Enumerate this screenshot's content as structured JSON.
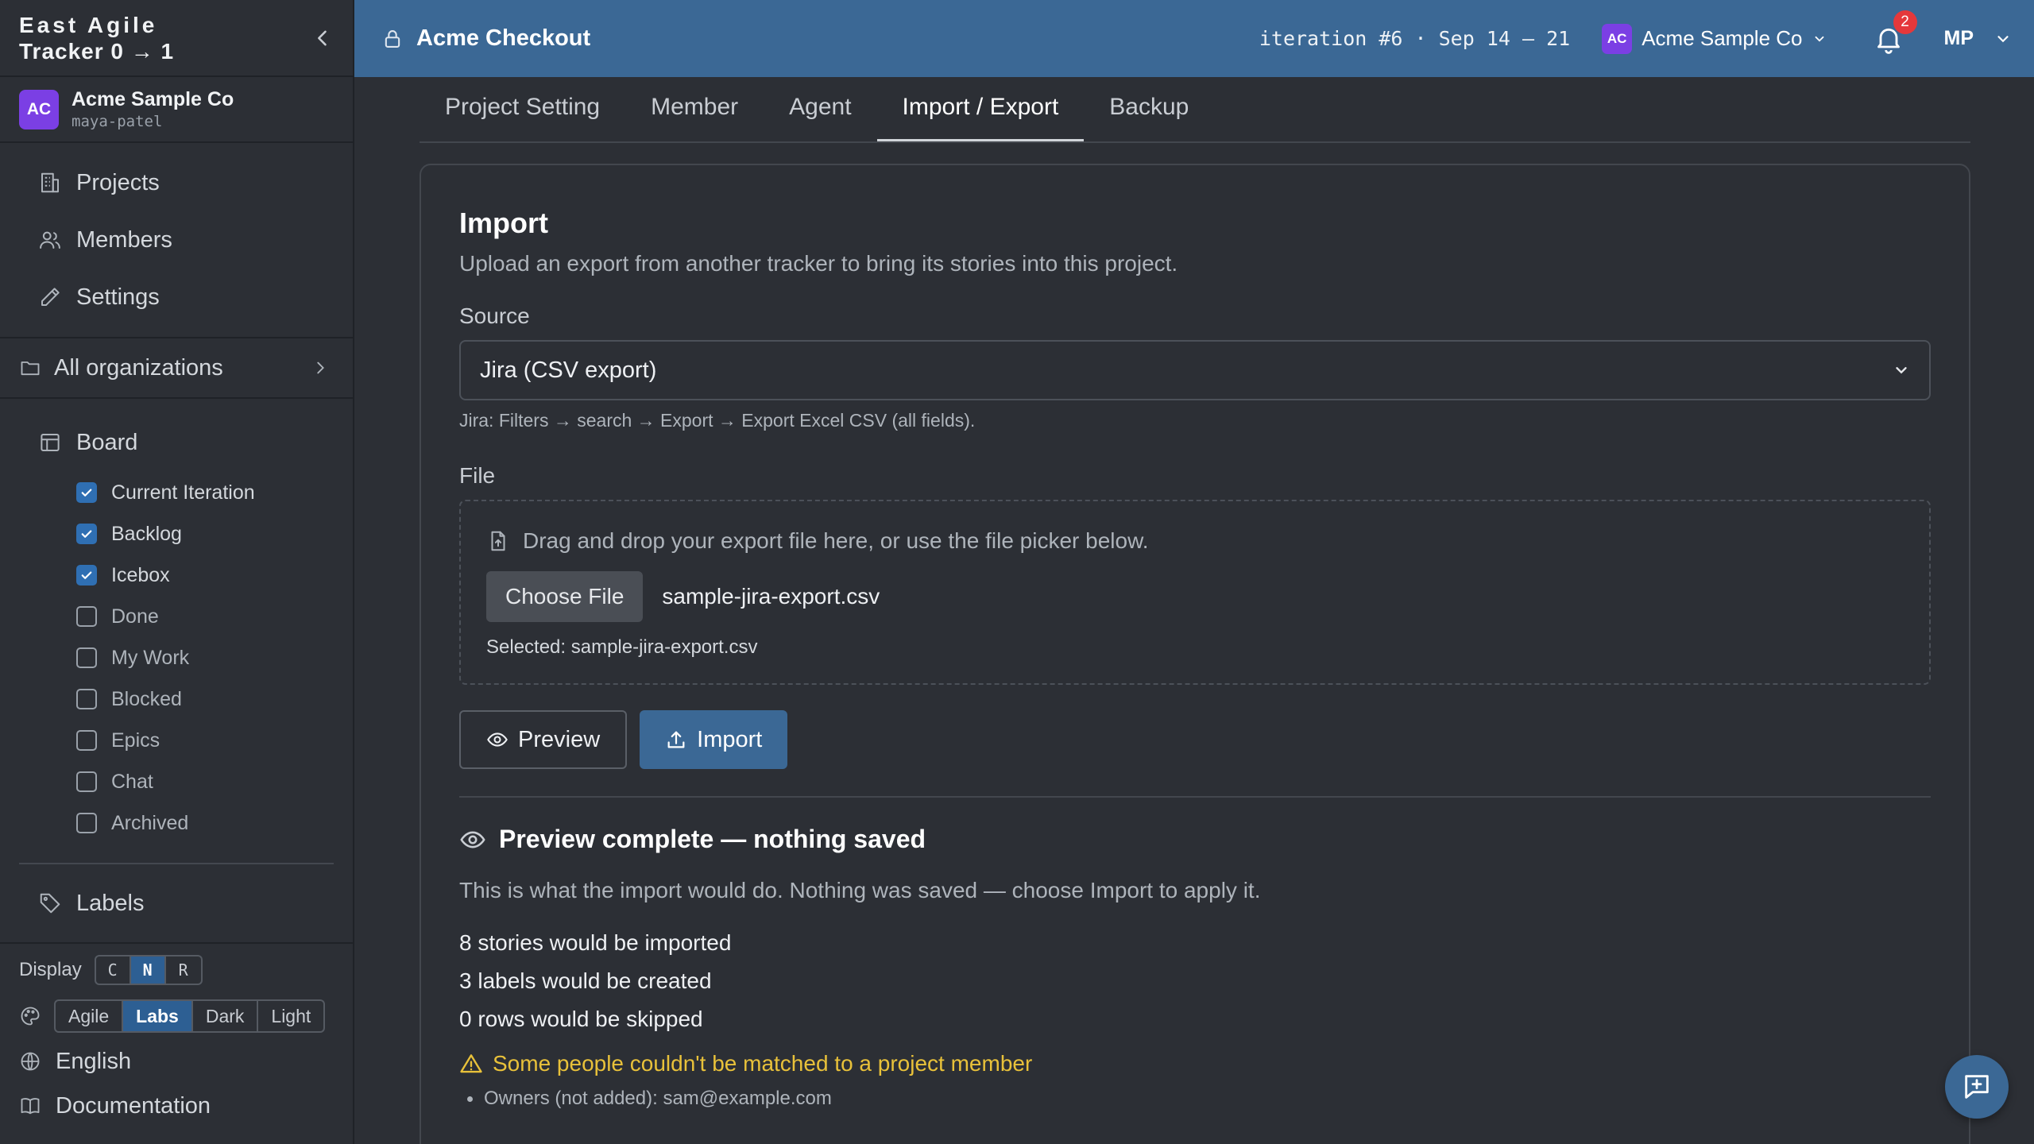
{
  "brand": {
    "line1": "East Agile",
    "line2": "Tracker 0 → 1"
  },
  "org": {
    "avatar": "AC",
    "name": "Acme Sample Co",
    "user": "maya-patel"
  },
  "nav": [
    {
      "label": "Projects",
      "icon": "building-icon"
    },
    {
      "label": "Members",
      "icon": "users-icon"
    },
    {
      "label": "Settings",
      "icon": "pencil-icon"
    }
  ],
  "all_orgs": "All organizations",
  "board": {
    "label": "Board",
    "items": [
      {
        "label": "Current Iteration",
        "checked": true
      },
      {
        "label": "Backlog",
        "checked": true
      },
      {
        "label": "Icebox",
        "checked": true
      },
      {
        "label": "Done",
        "checked": false
      },
      {
        "label": "My Work",
        "checked": false
      },
      {
        "label": "Blocked",
        "checked": false
      },
      {
        "label": "Epics",
        "checked": false
      },
      {
        "label": "Chat",
        "checked": false
      },
      {
        "label": "Archived",
        "checked": false
      }
    ]
  },
  "labels": "Labels",
  "display": {
    "label": "Display",
    "options": [
      "C",
      "N",
      "R"
    ],
    "selected": "N"
  },
  "theme": {
    "options": [
      "Agile",
      "Labs",
      "Dark",
      "Light"
    ],
    "selected": "Labs"
  },
  "language": "English",
  "documentation": "Documentation",
  "topbar": {
    "project": "Acme Checkout",
    "iteration": "iteration #6 · Sep 14 – 21",
    "org_avatar": "AC",
    "org_name": "Acme Sample Co",
    "notifications": "2",
    "user_initials": "MP"
  },
  "tabs": [
    "Project Setting",
    "Member",
    "Agent",
    "Import / Export",
    "Backup"
  ],
  "active_tab": "Import / Export",
  "import": {
    "title": "Import",
    "subtitle": "Upload an export from another tracker to bring its stories into this project.",
    "source_label": "Source",
    "source_value": "Jira (CSV export)",
    "source_hint": "Jira: Filters → search → Export → Export Excel CSV (all fields).",
    "file_label": "File",
    "dropzone_text": "Drag and drop your export file here, or use the file picker below.",
    "choose_file": "Choose File",
    "file_name": "sample-jira-export.csv",
    "selected_text": "Selected: sample-jira-export.csv",
    "preview_btn": "Preview",
    "import_btn": "Import"
  },
  "preview": {
    "title": "Preview complete — nothing saved",
    "text": "This is what the import would do. Nothing was saved — choose Import to apply it.",
    "stats": [
      "8 stories would be imported",
      "3 labels would be created",
      "0 rows would be skipped"
    ],
    "warning": "Some people couldn't be matched to a project member",
    "owners": "Owners (not added): sam@example.com"
  },
  "colors": {
    "accent": "#3b6895",
    "org_avatar": "#7b3fe4",
    "warning": "#e8c13a",
    "badge": "#e5383b"
  }
}
